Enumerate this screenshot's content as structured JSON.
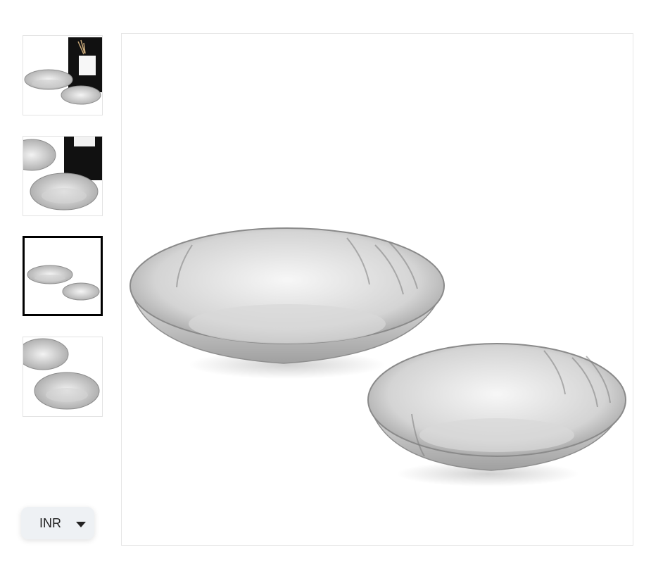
{
  "gallery": {
    "thumbnails": [
      {
        "icon": "bowls-with-card-photo",
        "selected": false
      },
      {
        "icon": "bowl-closeup-with-box-photo",
        "selected": false
      },
      {
        "icon": "two-bowls-photo",
        "selected": true
      },
      {
        "icon": "bowls-closeup-photo",
        "selected": false
      }
    ],
    "main_image_icon": "two-silver-bowls-photo",
    "colors": {
      "selected_border": "#000000",
      "thumb_border": "#e3e3e3"
    }
  },
  "currency_selector": {
    "value": "INR",
    "icon": "caret-down-icon",
    "background": "#eef1f4"
  }
}
